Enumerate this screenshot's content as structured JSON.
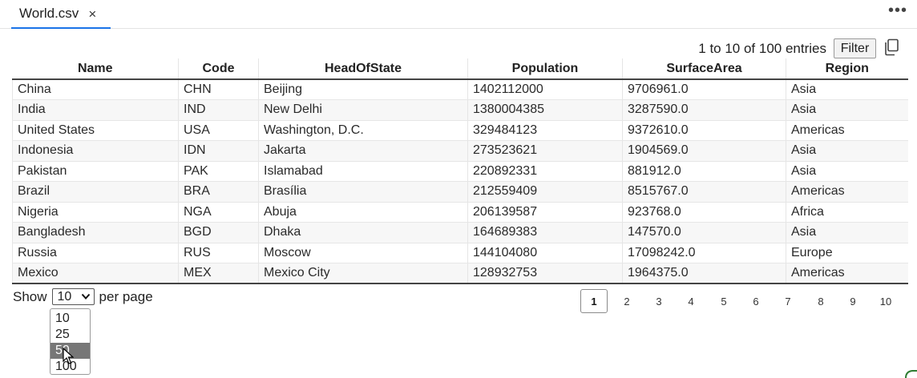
{
  "tab": {
    "title": "World.csv",
    "close": "×"
  },
  "more_menu": "•••",
  "summary": {
    "entries": "1 to 10 of 100 entries",
    "filter_label": "Filter"
  },
  "table": {
    "columns": [
      "Name",
      "Code",
      "HeadOfState",
      "Population",
      "SurfaceArea",
      "Region"
    ],
    "rows": [
      [
        "China",
        "CHN",
        "Beijing",
        "1402112000",
        "9706961.0",
        "Asia"
      ],
      [
        "India",
        "IND",
        "New Delhi",
        "1380004385",
        "3287590.0",
        "Asia"
      ],
      [
        "United States",
        "USA",
        "Washington, D.C.",
        "329484123",
        "9372610.0",
        "Americas"
      ],
      [
        "Indonesia",
        "IDN",
        "Jakarta",
        "273523621",
        "1904569.0",
        "Asia"
      ],
      [
        "Pakistan",
        "PAK",
        "Islamabad",
        "220892331",
        "881912.0",
        "Asia"
      ],
      [
        "Brazil",
        "BRA",
        "Brasília",
        "212559409",
        "8515767.0",
        "Americas"
      ],
      [
        "Nigeria",
        "NGA",
        "Abuja",
        "206139587",
        "923768.0",
        "Africa"
      ],
      [
        "Bangladesh",
        "BGD",
        "Dhaka",
        "164689383",
        "147570.0",
        "Asia"
      ],
      [
        "Russia",
        "RUS",
        "Moscow",
        "144104080",
        "17098242.0",
        "Europe"
      ],
      [
        "Mexico",
        "MEX",
        "Mexico City",
        "128932753",
        "1964375.0",
        "Americas"
      ]
    ]
  },
  "footer": {
    "show_label": "Show",
    "per_page_label": "per page",
    "selected": "10",
    "options": [
      "10",
      "25",
      "50",
      "100"
    ],
    "highlighted_option": "50"
  },
  "pagination": {
    "pages": [
      "1",
      "2",
      "3",
      "4",
      "5",
      "6",
      "7",
      "8",
      "9",
      "10"
    ],
    "current": "1"
  },
  "colors": {
    "accent": "#1a73e8",
    "highlight": "#777777"
  },
  "icons": {
    "copy": "copy-icon",
    "chevron": "chevron-down-icon",
    "cursor": "mouse-pointer-icon"
  }
}
